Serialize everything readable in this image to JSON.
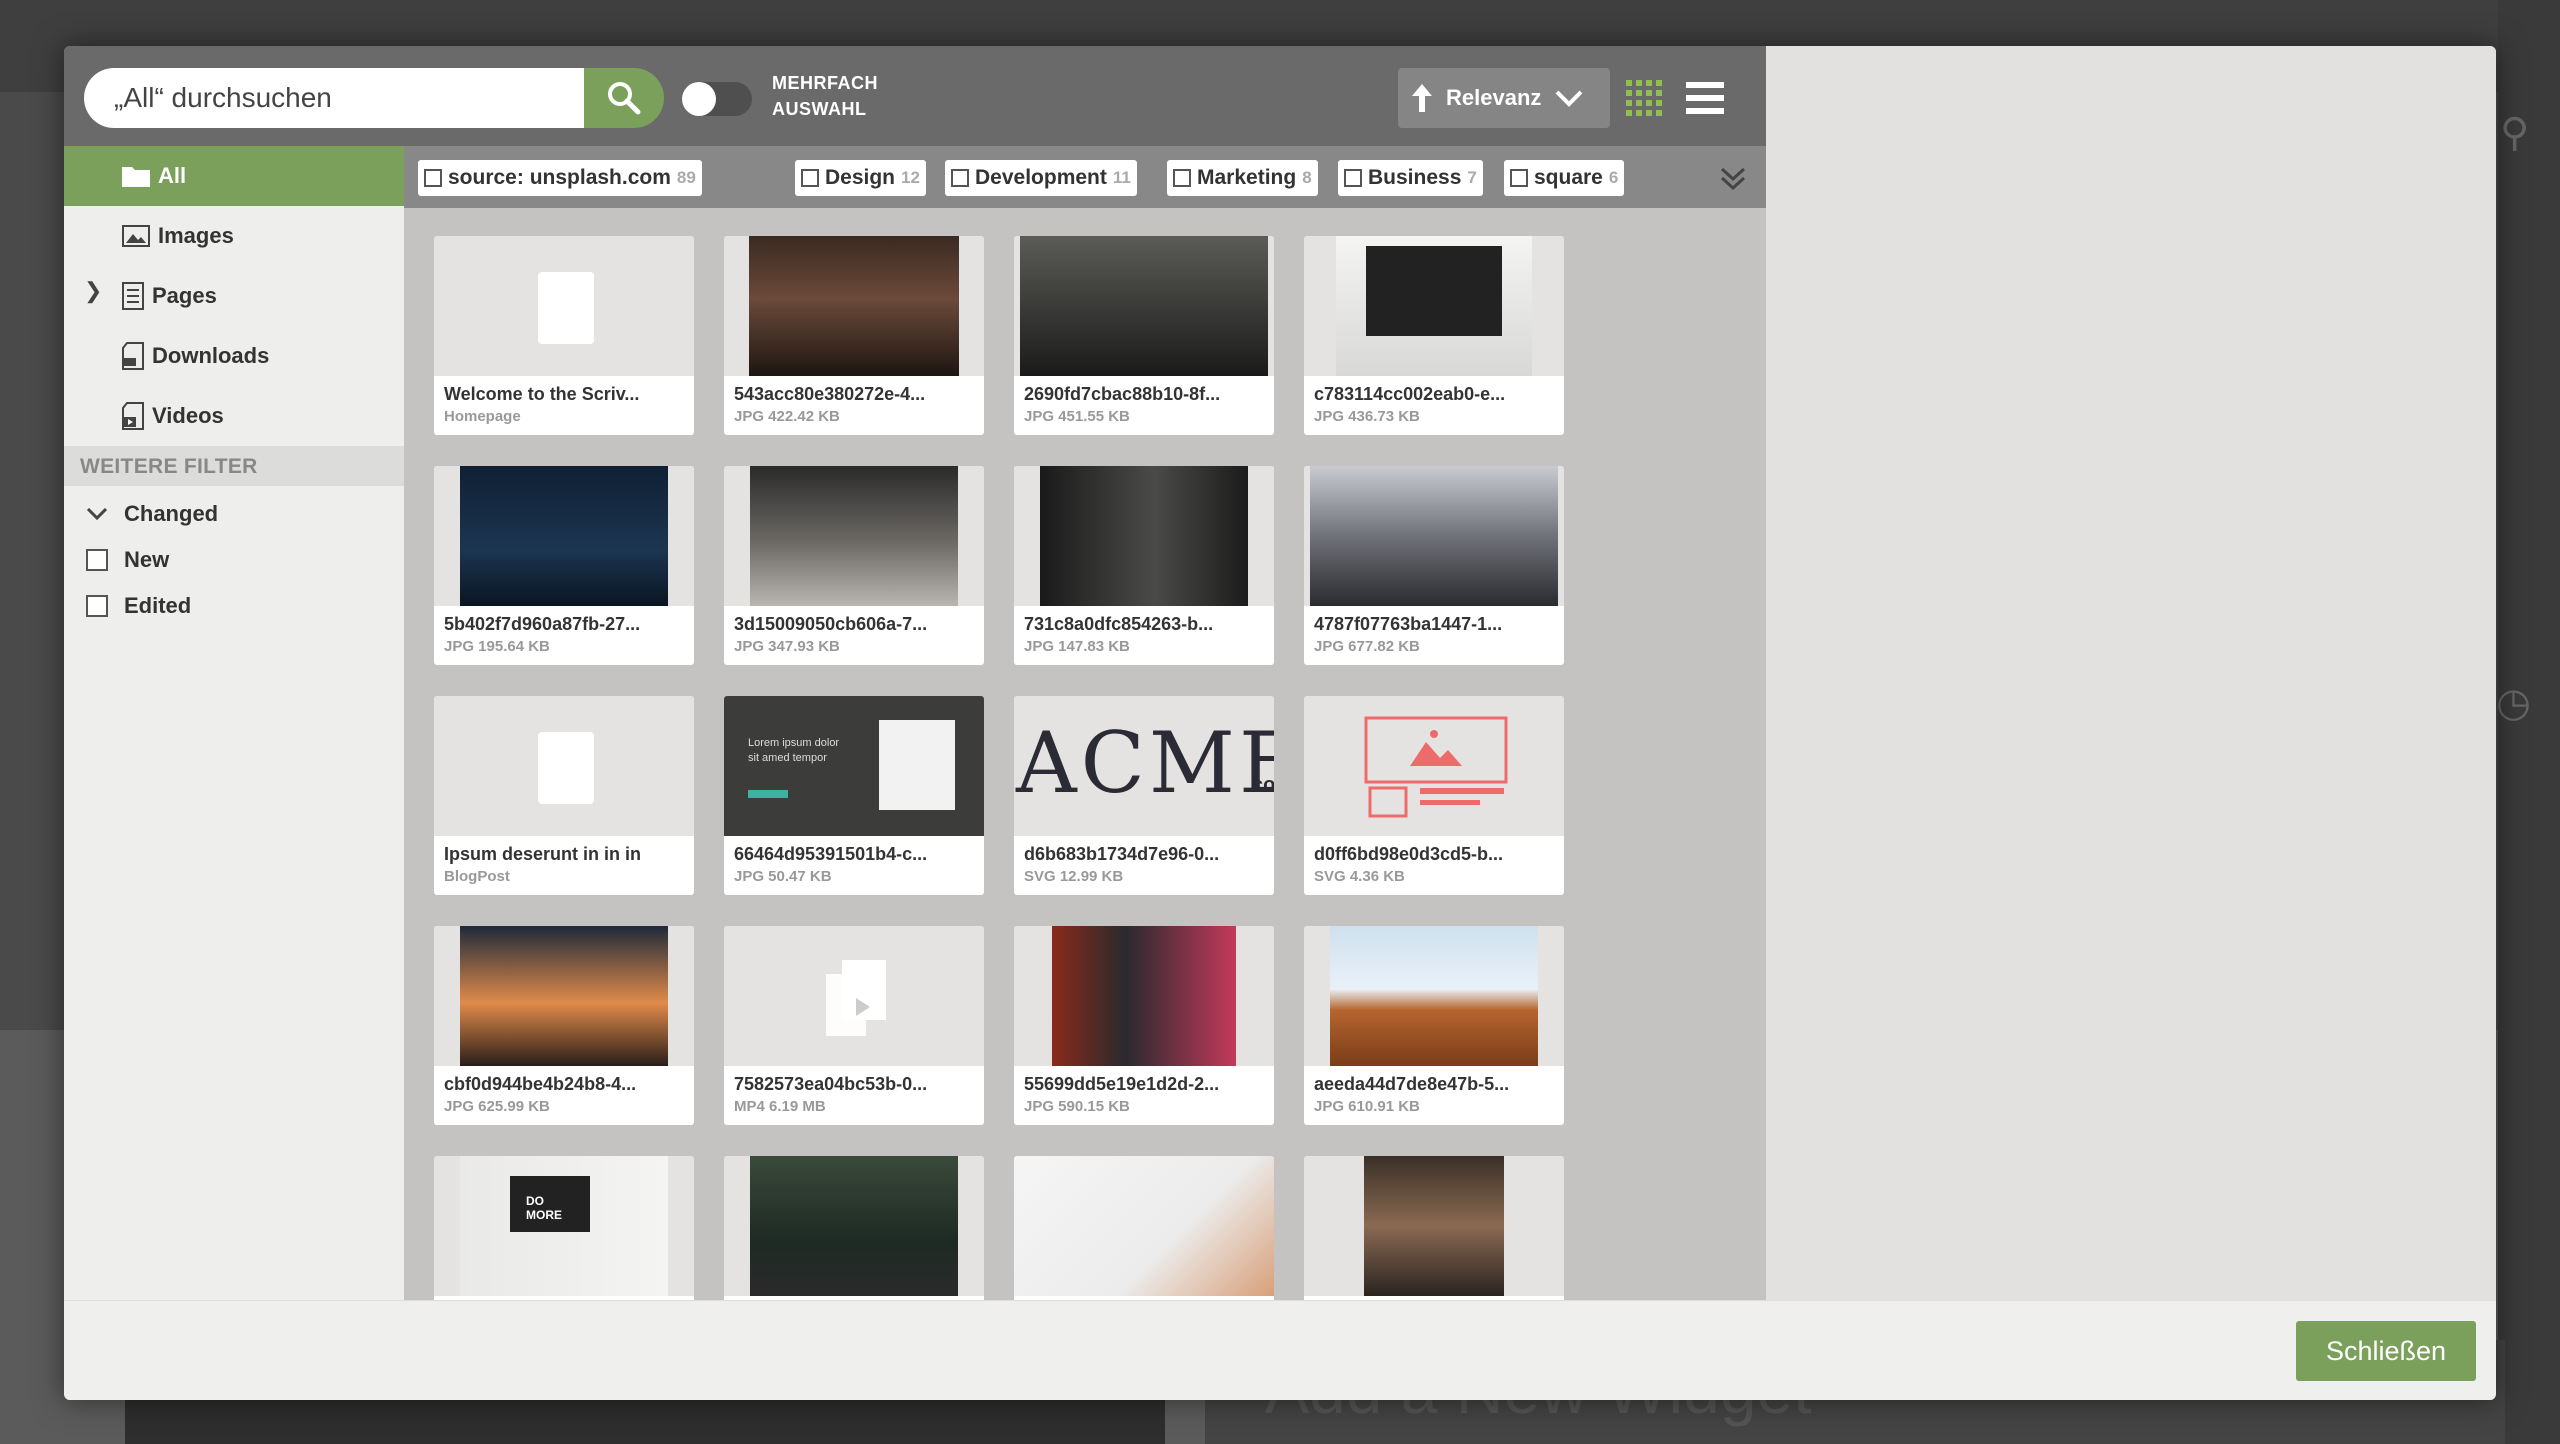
{
  "search": {
    "placeholder": "„All“ durchsuchen"
  },
  "multi_select": {
    "line1": "MEHRFACH",
    "line2": "AUSWAHL"
  },
  "sort": {
    "label": "Relevanz"
  },
  "sidebar": {
    "items": [
      {
        "label": "All",
        "icon": "folder-icon"
      },
      {
        "label": "Images",
        "icon": "image-icon"
      },
      {
        "label": "Pages",
        "icon": "page-icon"
      },
      {
        "label": "Downloads",
        "icon": "download-icon"
      },
      {
        "label": "Videos",
        "icon": "video-icon"
      }
    ],
    "filter_heading": "WEITERE FILTER",
    "filters": [
      {
        "label": "Changed"
      },
      {
        "label": "New"
      },
      {
        "label": "Edited"
      }
    ]
  },
  "tags": [
    {
      "label": "source: unsplash.com",
      "count": "89"
    },
    {
      "label": "Design",
      "count": "12"
    },
    {
      "label": "Development",
      "count": "11"
    },
    {
      "label": "Marketing",
      "count": "8"
    },
    {
      "label": "Business",
      "count": "7"
    },
    {
      "label": "square",
      "count": "6"
    }
  ],
  "cards": [
    {
      "title": "Welcome to the Scriv...",
      "sub": "Homepage"
    },
    {
      "title": "543acc80e380272e-4...",
      "sub": "JPG 422.42 KB"
    },
    {
      "title": "2690fd7cbac88b10-8f...",
      "sub": "JPG 451.55 KB"
    },
    {
      "title": "c783114cc002eab0-e...",
      "sub": "JPG 436.73 KB"
    },
    {
      "title": "5b402f7d960a87fb-27...",
      "sub": "JPG 195.64 KB"
    },
    {
      "title": "3d15009050cb606a-7...",
      "sub": "JPG 347.93 KB"
    },
    {
      "title": "731c8a0dfc854263-b...",
      "sub": "JPG 147.83 KB"
    },
    {
      "title": "4787f07763ba1447-1...",
      "sub": "JPG 677.82 KB"
    },
    {
      "title": "Ipsum deserunt in in in",
      "sub": "BlogPost"
    },
    {
      "title": "66464d95391501b4-c...",
      "sub": "JPG 50.47 KB"
    },
    {
      "title": "d6b683b1734d7e96-0...",
      "sub": "SVG 12.99 KB"
    },
    {
      "title": "d0ff6bd98e0d3cd5-b...",
      "sub": "SVG 4.36 KB"
    },
    {
      "title": "cbf0d944be4b24b8-4...",
      "sub": "JPG 625.99 KB"
    },
    {
      "title": "7582573ea04bc53b-0...",
      "sub": "MP4 6.19 MB"
    },
    {
      "title": "55699dd5e19e1d2d-2...",
      "sub": "JPG 590.15 KB"
    },
    {
      "title": "aeeda44d7de8e47b-5...",
      "sub": "JPG 610.91 KB"
    },
    {
      "title": "",
      "sub": ""
    },
    {
      "title": "",
      "sub": ""
    },
    {
      "title": "",
      "sub": ""
    },
    {
      "title": "",
      "sub": ""
    }
  ],
  "thumb_texts": {
    "lorem_line1": "Lorem ipsum dolor",
    "lorem_line2": "sit amed tempor",
    "acme": "ACME",
    "acme_co": "co",
    "do_more": "DO MORE"
  },
  "footer": {
    "close_label": "Schließen"
  },
  "background": {
    "widget_heading": "Add a New Widget"
  },
  "colors": {
    "accent": "#7aa05c",
    "topbar": "#6a6a6a",
    "tagbar": "#888888"
  }
}
